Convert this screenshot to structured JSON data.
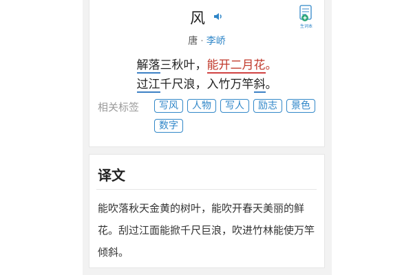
{
  "poem": {
    "title": "风",
    "dynasty": "唐",
    "separator": "·",
    "author": "李峤",
    "line1": {
      "part1": "解落",
      "part2": "三秋叶，",
      "part3": "能开二月花",
      "part4": "。"
    },
    "line2": {
      "part1": "过江",
      "part2": "千尺浪，入竹万竿",
      "part3": "斜",
      "part4": "。"
    }
  },
  "tags": {
    "label": "相关标签",
    "items": [
      "写风",
      "人物",
      "写人",
      "励志",
      "景色",
      "数字"
    ]
  },
  "notebook": {
    "label": "生词本"
  },
  "translation": {
    "heading": "译文",
    "text": "能吹落秋天金黄的树叶，能吹开春天美丽的鲜花。刮过江面能掀千尺巨浪，吹进竹林能使万竿倾斜。"
  },
  "colors": {
    "accent": "#2f86c8",
    "highlight_red": "#c0392b"
  }
}
